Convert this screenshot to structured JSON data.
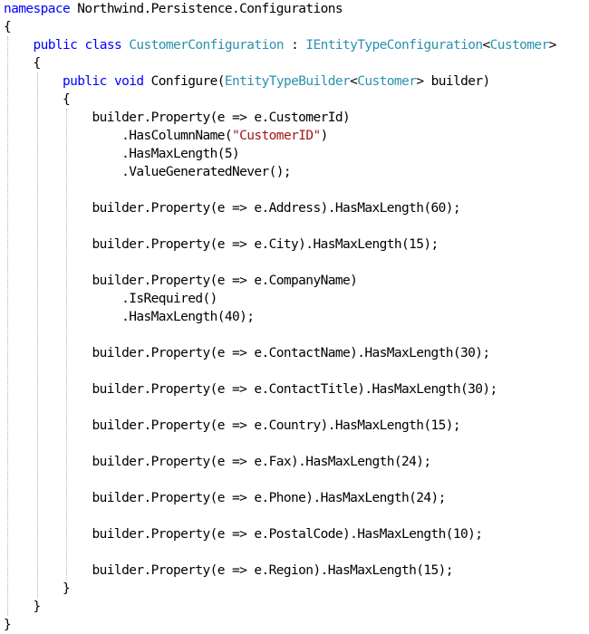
{
  "editor": {
    "colors": {
      "background": "#ffffff",
      "keyword": "#0000ff",
      "type": "#2b91af",
      "string": "#a31515",
      "plain": "#000000",
      "indent_guide": "#b4b4b4"
    },
    "lines": [
      {
        "indent": 0,
        "tokens": [
          {
            "t": "namespace",
            "k": "keyword"
          },
          {
            "t": " Northwind.Persistence.Configurations",
            "k": "plain"
          }
        ]
      },
      {
        "indent": 0,
        "tokens": [
          {
            "t": "{",
            "k": "plain"
          }
        ]
      },
      {
        "indent": 1,
        "tokens": [
          {
            "t": "public",
            "k": "keyword"
          },
          {
            "t": " ",
            "k": "plain"
          },
          {
            "t": "class",
            "k": "keyword"
          },
          {
            "t": " ",
            "k": "plain"
          },
          {
            "t": "CustomerConfiguration",
            "k": "type"
          },
          {
            "t": " : ",
            "k": "plain"
          },
          {
            "t": "IEntityTypeConfiguration",
            "k": "type"
          },
          {
            "t": "<",
            "k": "plain"
          },
          {
            "t": "Customer",
            "k": "type"
          },
          {
            "t": ">",
            "k": "plain"
          }
        ]
      },
      {
        "indent": 1,
        "tokens": [
          {
            "t": "{",
            "k": "plain"
          }
        ]
      },
      {
        "indent": 2,
        "tokens": [
          {
            "t": "public",
            "k": "keyword"
          },
          {
            "t": " ",
            "k": "plain"
          },
          {
            "t": "void",
            "k": "keyword"
          },
          {
            "t": " Configure(",
            "k": "plain"
          },
          {
            "t": "EntityTypeBuilder",
            "k": "type"
          },
          {
            "t": "<",
            "k": "plain"
          },
          {
            "t": "Customer",
            "k": "type"
          },
          {
            "t": "> builder)",
            "k": "plain"
          }
        ]
      },
      {
        "indent": 2,
        "tokens": [
          {
            "t": "{",
            "k": "plain"
          }
        ]
      },
      {
        "indent": 3,
        "tokens": [
          {
            "t": "builder.Property(e => e.CustomerId)",
            "k": "plain"
          }
        ]
      },
      {
        "indent": 4,
        "tokens": [
          {
            "t": ".HasColumnName(",
            "k": "plain"
          },
          {
            "t": "\"CustomerID\"",
            "k": "string"
          },
          {
            "t": ")",
            "k": "plain"
          }
        ]
      },
      {
        "indent": 4,
        "tokens": [
          {
            "t": ".HasMaxLength(5)",
            "k": "plain"
          }
        ]
      },
      {
        "indent": 4,
        "tokens": [
          {
            "t": ".ValueGeneratedNever();",
            "k": "plain"
          }
        ]
      },
      {
        "indent": 0,
        "tokens": []
      },
      {
        "indent": 3,
        "tokens": [
          {
            "t": "builder.Property(e => e.Address).HasMaxLength(60);",
            "k": "plain"
          }
        ]
      },
      {
        "indent": 0,
        "tokens": []
      },
      {
        "indent": 3,
        "tokens": [
          {
            "t": "builder.Property(e => e.City).HasMaxLength(15);",
            "k": "plain"
          }
        ]
      },
      {
        "indent": 0,
        "tokens": []
      },
      {
        "indent": 3,
        "tokens": [
          {
            "t": "builder.Property(e => e.CompanyName)",
            "k": "plain"
          }
        ]
      },
      {
        "indent": 4,
        "tokens": [
          {
            "t": ".IsRequired()",
            "k": "plain"
          }
        ]
      },
      {
        "indent": 4,
        "tokens": [
          {
            "t": ".HasMaxLength(40);",
            "k": "plain"
          }
        ]
      },
      {
        "indent": 0,
        "tokens": []
      },
      {
        "indent": 3,
        "tokens": [
          {
            "t": "builder.Property(e => e.ContactName).HasMaxLength(30);",
            "k": "plain"
          }
        ]
      },
      {
        "indent": 0,
        "tokens": []
      },
      {
        "indent": 3,
        "tokens": [
          {
            "t": "builder.Property(e => e.ContactTitle).HasMaxLength(30);",
            "k": "plain"
          }
        ]
      },
      {
        "indent": 0,
        "tokens": []
      },
      {
        "indent": 3,
        "tokens": [
          {
            "t": "builder.Property(e => e.Country).HasMaxLength(15);",
            "k": "plain"
          }
        ]
      },
      {
        "indent": 0,
        "tokens": []
      },
      {
        "indent": 3,
        "tokens": [
          {
            "t": "builder.Property(e => e.Fax).HasMaxLength(24);",
            "k": "plain"
          }
        ]
      },
      {
        "indent": 0,
        "tokens": []
      },
      {
        "indent": 3,
        "tokens": [
          {
            "t": "builder.Property(e => e.Phone).HasMaxLength(24);",
            "k": "plain"
          }
        ]
      },
      {
        "indent": 0,
        "tokens": []
      },
      {
        "indent": 3,
        "tokens": [
          {
            "t": "builder.Property(e => e.PostalCode).HasMaxLength(10);",
            "k": "plain"
          }
        ]
      },
      {
        "indent": 0,
        "tokens": []
      },
      {
        "indent": 3,
        "tokens": [
          {
            "t": "builder.Property(e => e.Region).HasMaxLength(15);",
            "k": "plain"
          }
        ]
      },
      {
        "indent": 2,
        "tokens": [
          {
            "t": "}",
            "k": "plain"
          }
        ]
      },
      {
        "indent": 1,
        "tokens": [
          {
            "t": "}",
            "k": "plain"
          }
        ]
      },
      {
        "indent": 0,
        "tokens": [
          {
            "t": "}",
            "k": "plain"
          }
        ]
      }
    ]
  }
}
